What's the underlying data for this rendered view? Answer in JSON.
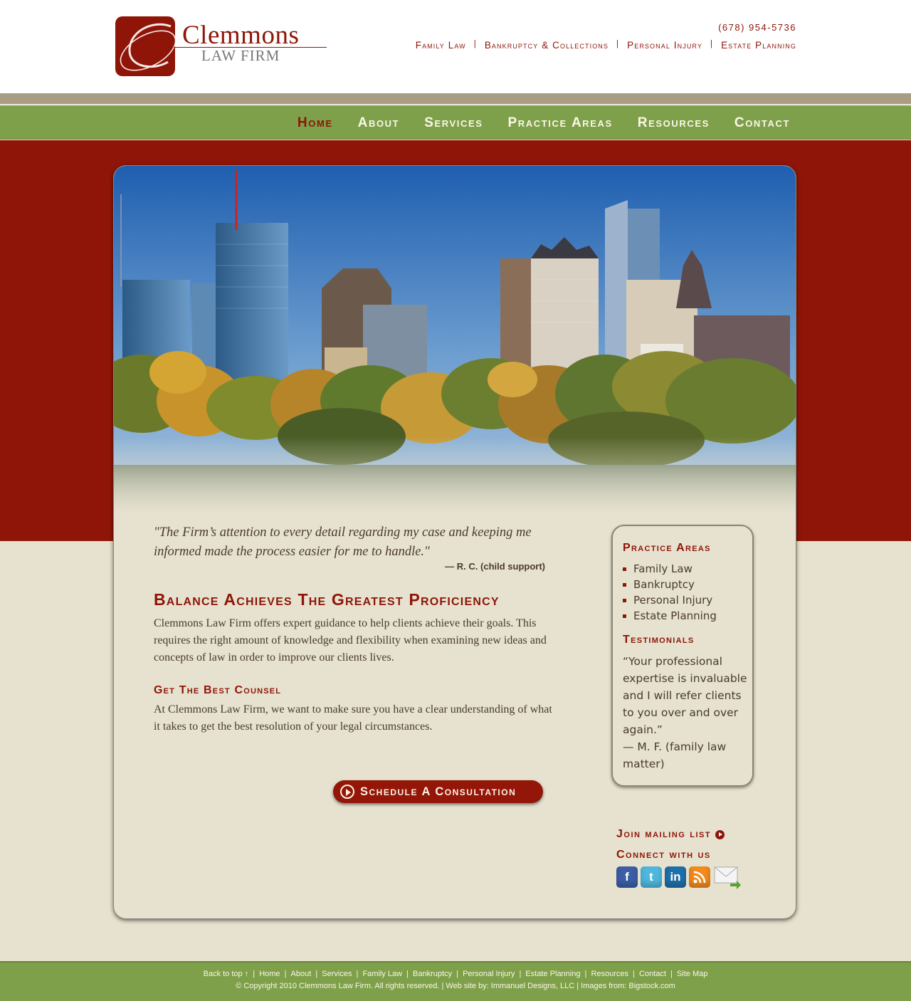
{
  "header": {
    "logo_name": "Clemmons",
    "logo_sub": "LAW FIRM",
    "phone": "(678) 954-5736",
    "top_links": [
      "Family Law",
      "Bankruptcy & Collections",
      "Personal Injury",
      "Estate Planning"
    ],
    "separator": "|"
  },
  "nav": {
    "items": [
      "Home",
      "About",
      "Services",
      "Practice Areas",
      "Resources",
      "Contact"
    ],
    "active": "Home"
  },
  "main": {
    "quote": "\"The Firm’s attention to every detail regarding my case and keeping me informed made the process easier for me to handle.\"",
    "quote_attribution": "— R. C. (child support)",
    "heading": "Balance Achieves The Greatest Proficiency",
    "paragraph1": "Clemmons Law Firm offers expert guidance to help clients achieve their goals. This requires the right amount of knowledge and flexibility when examining new ideas and concepts of law in order to improve our clients lives.",
    "subheading": "Get The Best Counsel",
    "paragraph2": "At Clemmons Law Firm, we want to make sure you have a clear understanding of what it takes to get the best resolution of your legal circumstances.",
    "cta_label": "Schedule A Consultation"
  },
  "sidebar": {
    "practice_heading": "Practice Areas",
    "practice_items": [
      "Family Law",
      "Bankruptcy",
      "Personal Injury",
      "Estate Planning"
    ],
    "testimonials_heading": "Testimonials",
    "testimonial": "“Your professional expertise is invaluable and I will refer clients to you over and over again.”",
    "testimonial_attribution": "— M. F. (family law matter)"
  },
  "social": {
    "join_label": "Join mailing list",
    "connect_label": "Connect with us",
    "icons": [
      "facebook-icon",
      "twitter-icon",
      "linkedin-icon",
      "rss-icon",
      "email-icon"
    ]
  },
  "footer": {
    "back_to_top": "Back to top ↑",
    "links": [
      "Home",
      "About",
      "Services",
      "Family Law",
      "Bankruptcy",
      "Personal Injury",
      "Estate Planning",
      "Resources",
      "Contact",
      "Site Map"
    ],
    "copyright": "© Copyright 2010 Clemmons Law Firm. All rights reserved. | Web site by:  Immanuel Designs, LLC   |  Images from:  Bigstock.com"
  },
  "colors": {
    "brand_red": "#8e1508",
    "nav_green": "#7ea04a",
    "background_beige": "#e6e2cf"
  }
}
